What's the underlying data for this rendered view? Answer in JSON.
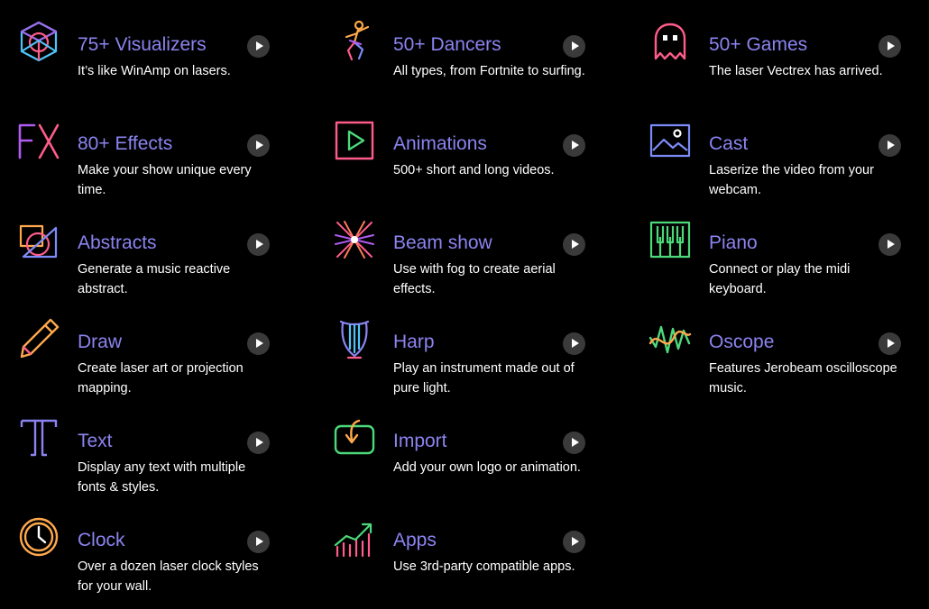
{
  "items": [
    {
      "title": "75+ Visualizers",
      "desc": "It’s like WinAmp on lasers.",
      "icon": "cube-icon"
    },
    {
      "title": "50+ Dancers",
      "desc": "All types, from Fortnite to surfing.",
      "icon": "dancer-icon"
    },
    {
      "title": "50+ Games",
      "desc": "The laser Vectrex has arrived.",
      "icon": "ghost-icon"
    },
    {
      "title": "80+ Effects",
      "desc": "Make your show unique every time.",
      "icon": "fx-icon"
    },
    {
      "title": "Animations",
      "desc": "500+ short and long videos.",
      "icon": "play-square-icon"
    },
    {
      "title": "Cast",
      "desc": "Laserize the video from your webcam.",
      "icon": "image-icon"
    },
    {
      "title": "Abstracts",
      "desc": "Generate a music reactive abstract.",
      "icon": "abstract-shapes-icon"
    },
    {
      "title": "Beam show",
      "desc": "Use with fog to create aerial effects.",
      "icon": "beams-icon"
    },
    {
      "title": "Piano",
      "desc": "Connect or play the midi keyboard.",
      "icon": "piano-icon"
    },
    {
      "title": "Draw",
      "desc": "Create laser art or projection mapping.",
      "icon": "pencil-icon"
    },
    {
      "title": "Harp",
      "desc": "Play an instrument made out of pure light.",
      "icon": "harp-icon"
    },
    {
      "title": "Oscope",
      "desc": "Features Jerobeam oscilloscope music.",
      "icon": "waveform-icon"
    },
    {
      "title": "Text",
      "desc": "Display any text with multiple fonts & styles.",
      "icon": "letter-t-icon"
    },
    {
      "title": "Import",
      "desc": "Add your own logo or animation.",
      "icon": "import-icon"
    },
    {
      "title": "Clock",
      "desc": "Over a dozen laser clock styles for your wall.",
      "icon": "clock-icon"
    },
    {
      "title": "Apps",
      "desc": "Use 3rd-party compatible apps.",
      "icon": "chart-up-icon"
    }
  ],
  "colors": {
    "background": "#000000",
    "title": "#8b84f0",
    "description": "#ffffff",
    "play_button": "#3a3a3a"
  }
}
